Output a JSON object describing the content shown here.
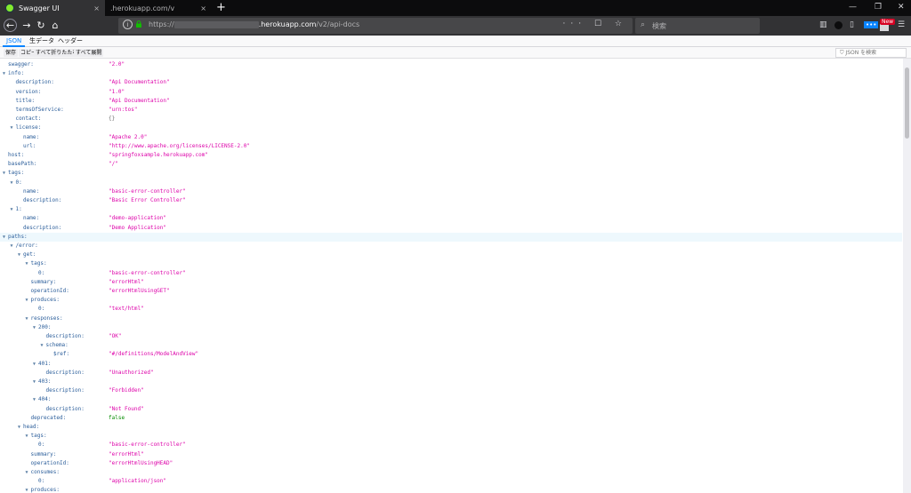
{
  "browser": {
    "tabs": [
      {
        "label": "Swagger UI",
        "close": "×"
      },
      {
        "label": ".herokuapp.com/v",
        "close": "×"
      }
    ],
    "new_tab": "+",
    "window_controls": [
      "—",
      "❐",
      "✕"
    ],
    "url": {
      "prefix": "https://",
      "host": ".herokuapp.com",
      "path": "/v2/api-docs"
    },
    "url_actions": "···  ☐  ☆",
    "search_placeholder": "検索",
    "new_badge": "New"
  },
  "viewer": {
    "tabs": [
      "JSON",
      "生データ",
      "ヘッダー"
    ],
    "buttons": [
      "保存",
      "コピー",
      "すべて折りたたむ",
      "すべて展開"
    ],
    "filter_placeholder": "JSON を検索"
  },
  "tree": [
    {
      "key": "swagger:",
      "value": "\"2.0\"",
      "type": "str",
      "depth": 0,
      "twisty": false
    },
    {
      "key": "info:",
      "value": "",
      "type": "",
      "depth": 0,
      "twisty": true
    },
    {
      "key": "description:",
      "value": "\"Api Documentation\"",
      "type": "str",
      "depth": 1,
      "twisty": false
    },
    {
      "key": "version:",
      "value": "\"1.0\"",
      "type": "str",
      "depth": 1,
      "twisty": false
    },
    {
      "key": "title:",
      "value": "\"Api Documentation\"",
      "type": "str",
      "depth": 1,
      "twisty": false
    },
    {
      "key": "termsOfService:",
      "value": "\"urn:tos\"",
      "type": "str",
      "depth": 1,
      "twisty": false
    },
    {
      "key": "contact:",
      "value": "{}",
      "type": "obj",
      "depth": 1,
      "twisty": false
    },
    {
      "key": "license:",
      "value": "",
      "type": "",
      "depth": 1,
      "twisty": true
    },
    {
      "key": "name:",
      "value": "\"Apache 2.0\"",
      "type": "str",
      "depth": 2,
      "twisty": false
    },
    {
      "key": "url:",
      "value": "\"http://www.apache.org/licenses/LICENSE-2.0\"",
      "type": "str",
      "depth": 2,
      "twisty": false
    },
    {
      "key": "host:",
      "value": "\"springfoxsample.herokuapp.com\"",
      "type": "str",
      "depth": 0,
      "twisty": false
    },
    {
      "key": "basePath:",
      "value": "\"/\"",
      "type": "str",
      "depth": 0,
      "twisty": false
    },
    {
      "key": "tags:",
      "value": "",
      "type": "",
      "depth": 0,
      "twisty": true
    },
    {
      "key": "0:",
      "value": "",
      "type": "",
      "depth": 1,
      "twisty": true
    },
    {
      "key": "name:",
      "value": "\"basic-error-controller\"",
      "type": "str",
      "depth": 2,
      "twisty": false
    },
    {
      "key": "description:",
      "value": "\"Basic Error Controller\"",
      "type": "str",
      "depth": 2,
      "twisty": false
    },
    {
      "key": "1:",
      "value": "",
      "type": "",
      "depth": 1,
      "twisty": true
    },
    {
      "key": "name:",
      "value": "\"demo-application\"",
      "type": "str",
      "depth": 2,
      "twisty": false
    },
    {
      "key": "description:",
      "value": "\"Demo Application\"",
      "type": "str",
      "depth": 2,
      "twisty": false
    },
    {
      "key": "paths:",
      "value": "",
      "type": "",
      "depth": 0,
      "twisty": true,
      "highlight": true
    },
    {
      "key": "/error:",
      "value": "",
      "type": "",
      "depth": 1,
      "twisty": true
    },
    {
      "key": "get:",
      "value": "",
      "type": "",
      "depth": 2,
      "twisty": true
    },
    {
      "key": "tags:",
      "value": "",
      "type": "",
      "depth": 3,
      "twisty": true
    },
    {
      "key": "0:",
      "value": "\"basic-error-controller\"",
      "type": "str",
      "depth": 4,
      "twisty": false
    },
    {
      "key": "summary:",
      "value": "\"errorHtml\"",
      "type": "str",
      "depth": 3,
      "twisty": false
    },
    {
      "key": "operationId:",
      "value": "\"errorHtmlUsingGET\"",
      "type": "str",
      "depth": 3,
      "twisty": false
    },
    {
      "key": "produces:",
      "value": "",
      "type": "",
      "depth": 3,
      "twisty": true
    },
    {
      "key": "0:",
      "value": "\"text/html\"",
      "type": "str",
      "depth": 4,
      "twisty": false
    },
    {
      "key": "responses:",
      "value": "",
      "type": "",
      "depth": 3,
      "twisty": true
    },
    {
      "key": "200:",
      "value": "",
      "type": "",
      "depth": 4,
      "twisty": true
    },
    {
      "key": "description:",
      "value": "\"OK\"",
      "type": "str",
      "depth": 5,
      "twisty": false
    },
    {
      "key": "schema:",
      "value": "",
      "type": "",
      "depth": 5,
      "twisty": true
    },
    {
      "key": "$ref:",
      "value": "\"#/definitions/ModelAndView\"",
      "type": "str",
      "depth": 6,
      "twisty": false
    },
    {
      "key": "401:",
      "value": "",
      "type": "",
      "depth": 4,
      "twisty": true
    },
    {
      "key": "description:",
      "value": "\"Unauthorized\"",
      "type": "str",
      "depth": 5,
      "twisty": false
    },
    {
      "key": "403:",
      "value": "",
      "type": "",
      "depth": 4,
      "twisty": true
    },
    {
      "key": "description:",
      "value": "\"Forbidden\"",
      "type": "str",
      "depth": 5,
      "twisty": false
    },
    {
      "key": "404:",
      "value": "",
      "type": "",
      "depth": 4,
      "twisty": true
    },
    {
      "key": "description:",
      "value": "\"Not Found\"",
      "type": "str",
      "depth": 5,
      "twisty": false
    },
    {
      "key": "deprecated:",
      "value": "false",
      "type": "bool",
      "depth": 3,
      "twisty": false
    },
    {
      "key": "head:",
      "value": "",
      "type": "",
      "depth": 2,
      "twisty": true
    },
    {
      "key": "tags:",
      "value": "",
      "type": "",
      "depth": 3,
      "twisty": true
    },
    {
      "key": "0:",
      "value": "\"basic-error-controller\"",
      "type": "str",
      "depth": 4,
      "twisty": false
    },
    {
      "key": "summary:",
      "value": "\"errorHtml\"",
      "type": "str",
      "depth": 3,
      "twisty": false
    },
    {
      "key": "operationId:",
      "value": "\"errorHtmlUsingHEAD\"",
      "type": "str",
      "depth": 3,
      "twisty": false
    },
    {
      "key": "consumes:",
      "value": "",
      "type": "",
      "depth": 3,
      "twisty": true
    },
    {
      "key": "0:",
      "value": "\"application/json\"",
      "type": "str",
      "depth": 4,
      "twisty": false
    },
    {
      "key": "produces:",
      "value": "",
      "type": "",
      "depth": 3,
      "twisty": true
    }
  ]
}
